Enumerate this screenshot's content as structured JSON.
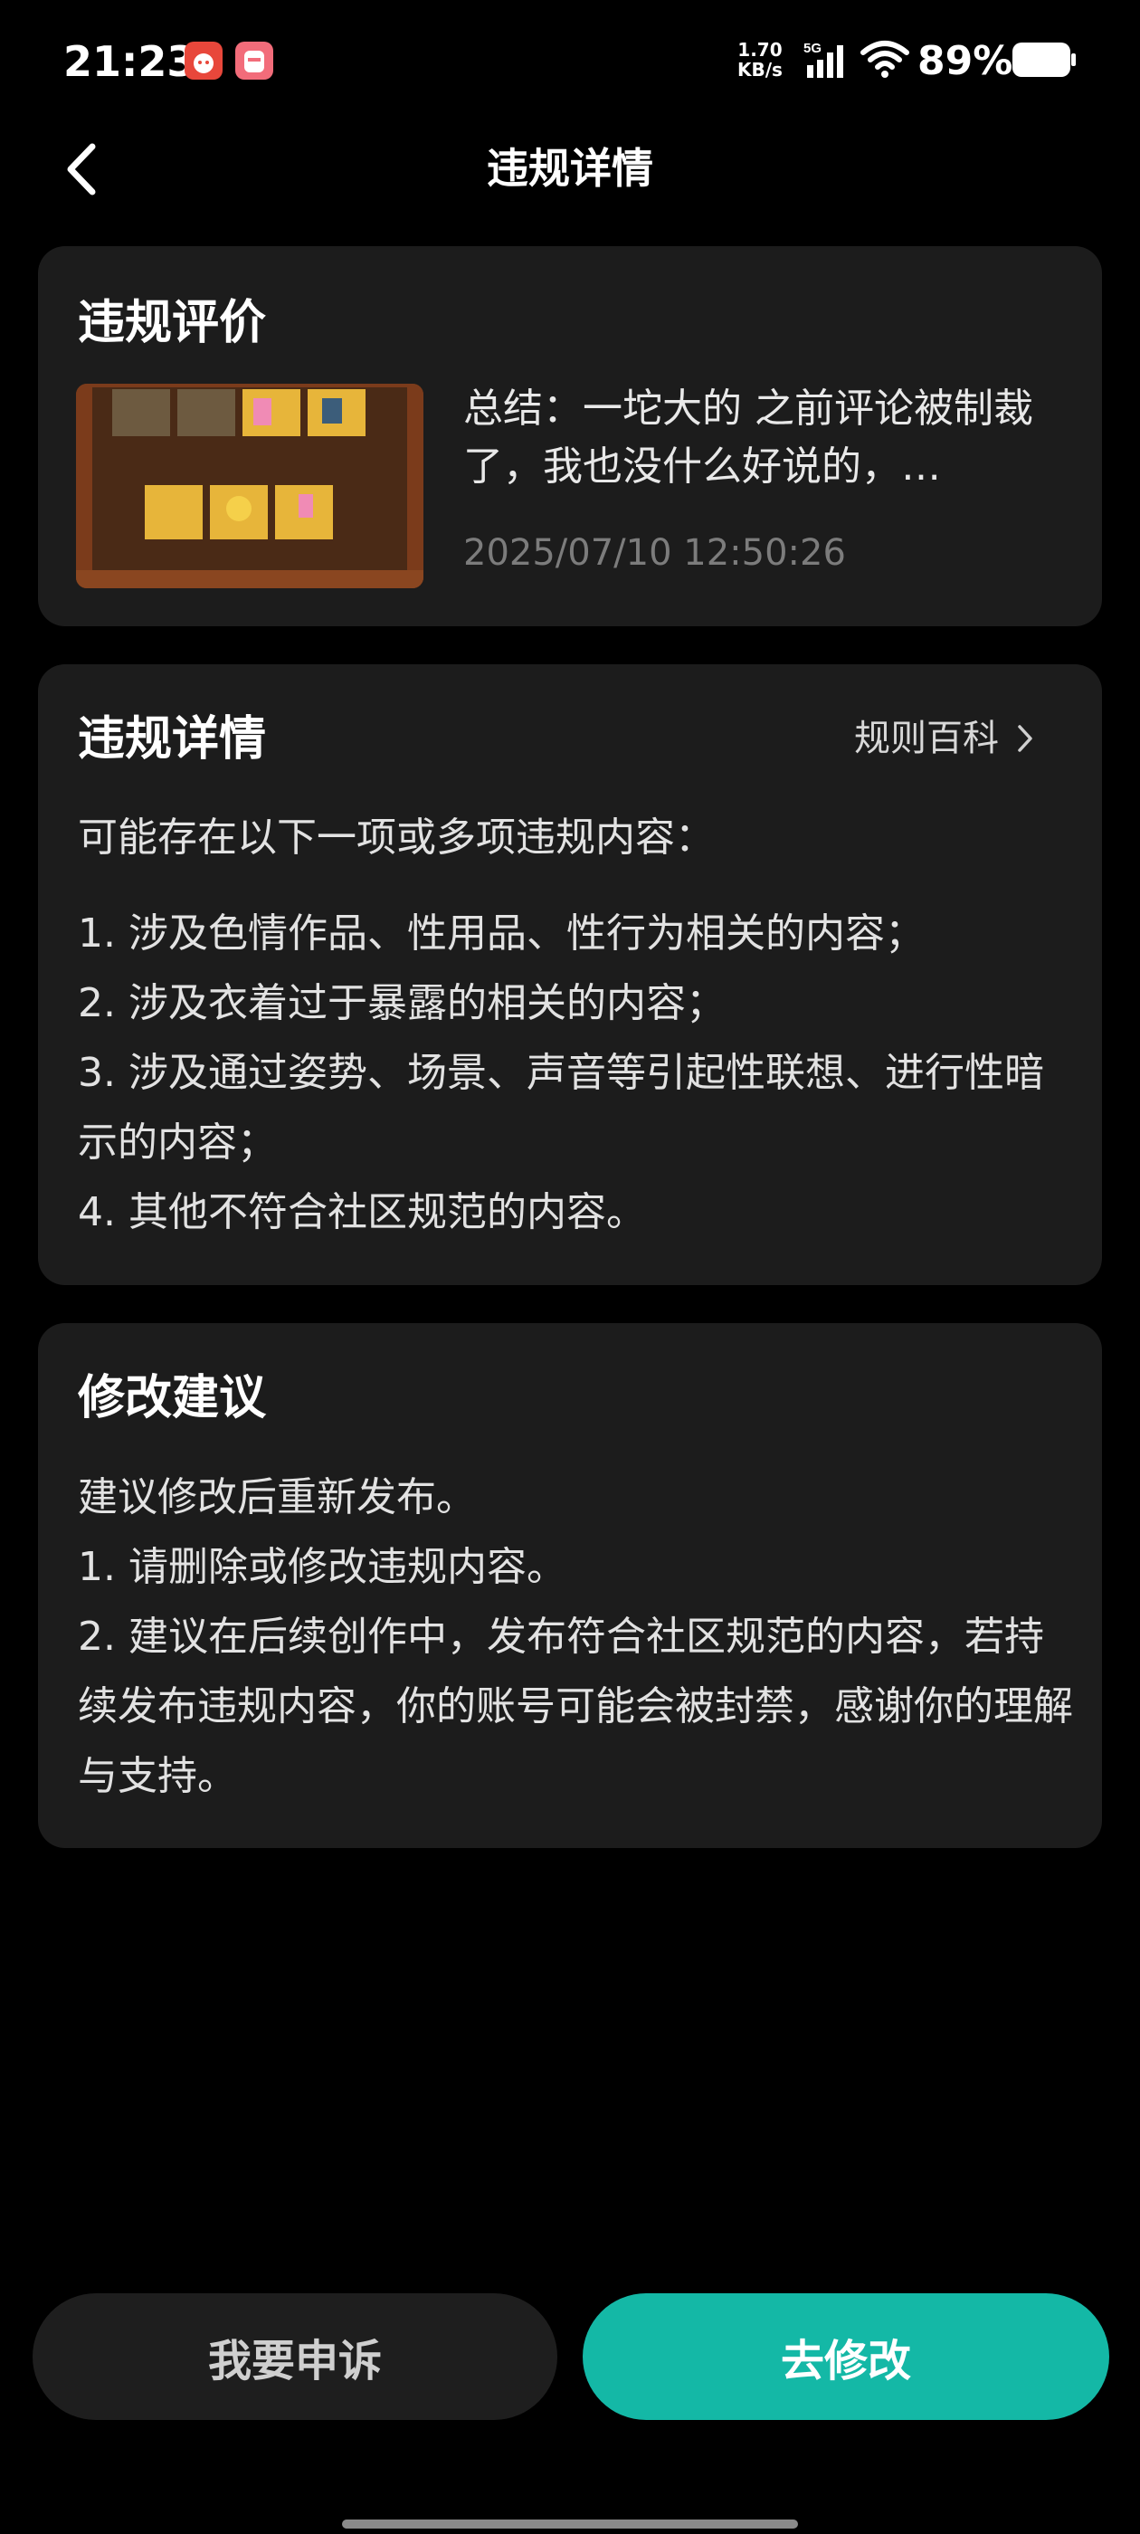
{
  "status_bar": {
    "time": "21:23",
    "net_speed_value": "1.70",
    "net_speed_unit": "KB/s",
    "network_type": "5G",
    "battery_percent": "89%",
    "icons": [
      "app-notification-icon",
      "app-notification-icon",
      "signal-icon",
      "wifi-icon",
      "battery-icon"
    ]
  },
  "nav": {
    "title": "违规详情",
    "back_icon": "chevron-left-icon"
  },
  "review_card": {
    "title": "违规评价",
    "text": "总结：一坨大的 之前评论被制裁了，我也没什么好说的，…",
    "timestamp": "2025/07/10 12:50:26"
  },
  "details_card": {
    "title": "违规详情",
    "rule_link": "规则百科",
    "intro": "可能存在以下一项或多项违规内容：",
    "items": [
      "1. 涉及色情作品、性用品、性行为相关的内容；",
      "2. 涉及衣着过于暴露的相关的内容；",
      "3. 涉及通过姿势、场景、声音等引起性联想、进行性暗示的内容；",
      "4. 其他不符合社区规范的内容。"
    ]
  },
  "suggestion_card": {
    "title": "修改建议",
    "lines": [
      "建议修改后重新发布。",
      "1. 请删除或修改违规内容。",
      "2. 建议在后续创作中，发布符合社区规范的内容，若持续发布违规内容，你的账号可能会被封禁，感谢你的理解与支持。"
    ]
  },
  "buttons": {
    "appeal": "我要申诉",
    "modify": "去修改"
  },
  "colors": {
    "background": "#000000",
    "card": "#1c1c1c",
    "accent": "#14b8a6"
  }
}
